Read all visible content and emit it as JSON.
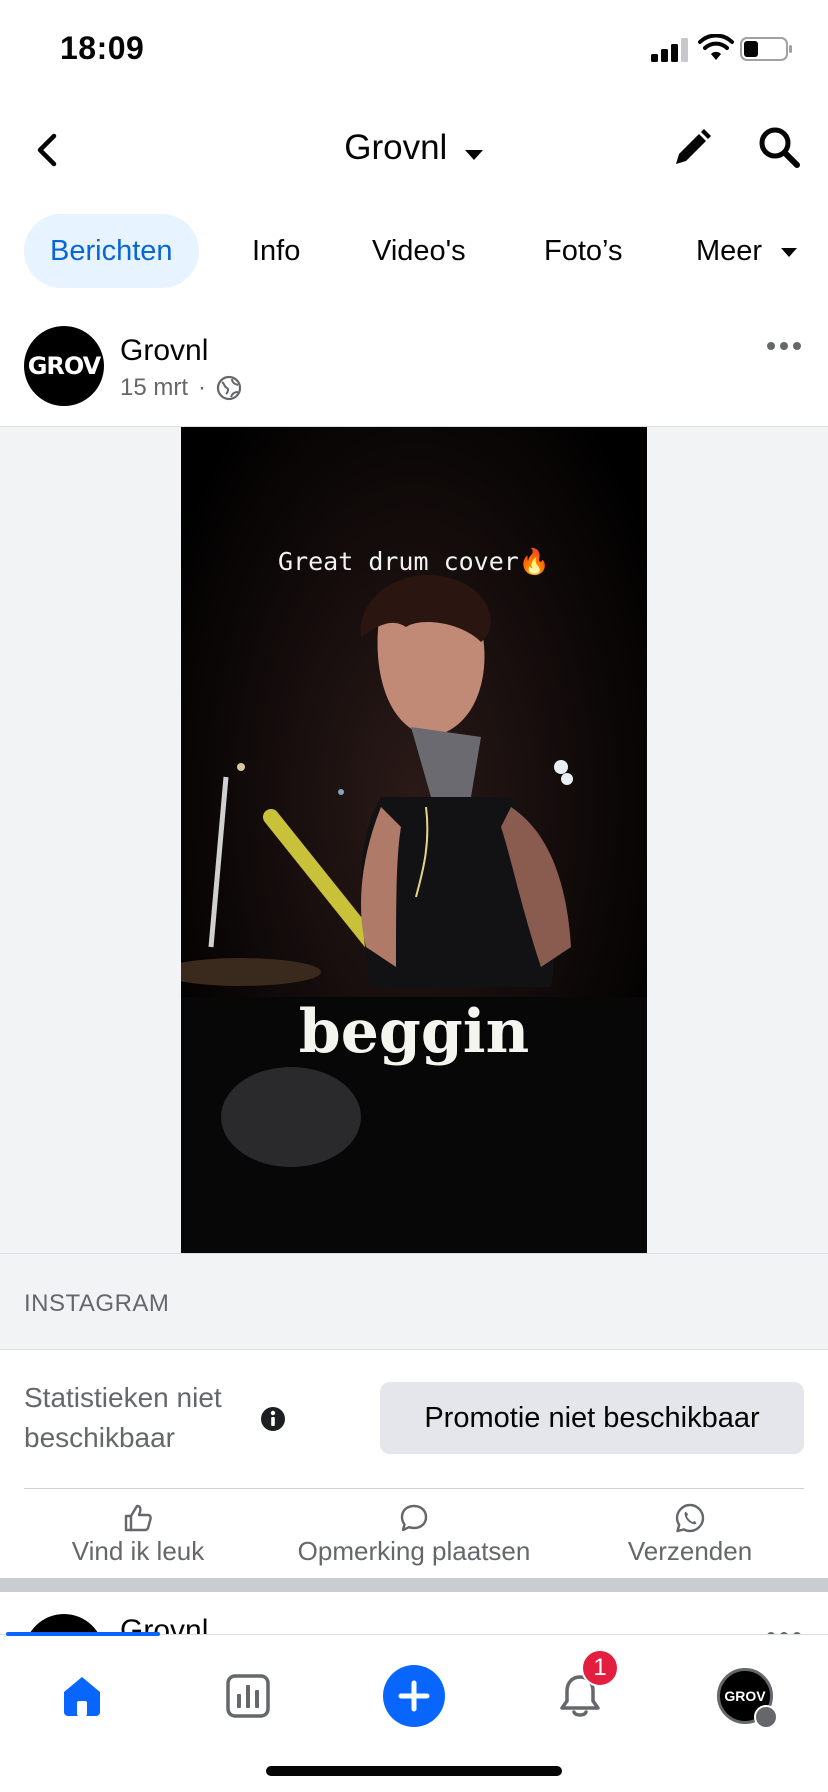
{
  "status_bar": {
    "time": "18:09"
  },
  "nav": {
    "title": "Grovnl"
  },
  "tabs": [
    {
      "label": "Berichten"
    },
    {
      "label": "Info"
    },
    {
      "label": "Video's"
    },
    {
      "label": "Foto’s"
    },
    {
      "label": "Meer"
    }
  ],
  "post": {
    "author": "Grovnl",
    "avatar_text": "GROV",
    "date": "15 mrt",
    "separator": "·",
    "video": {
      "caption": "Great drum cover🔥",
      "song": "beggin"
    },
    "source": "INSTAGRAM",
    "insights_text": "Statistieken niet beschikbaar",
    "promo_button": "Promotie niet beschikbaar",
    "actions": [
      {
        "label": "Vind ik leuk",
        "icon": "like-icon"
      },
      {
        "label": "Opmerking plaatsen",
        "icon": "comment-icon"
      },
      {
        "label": "Verzenden",
        "icon": "whatsapp-icon"
      }
    ]
  },
  "next_post": {
    "author": "Grovnl"
  },
  "bottom_bar": {
    "notification_count": "1",
    "profile_text": "GROV",
    "accent_color": "#0866ff"
  }
}
